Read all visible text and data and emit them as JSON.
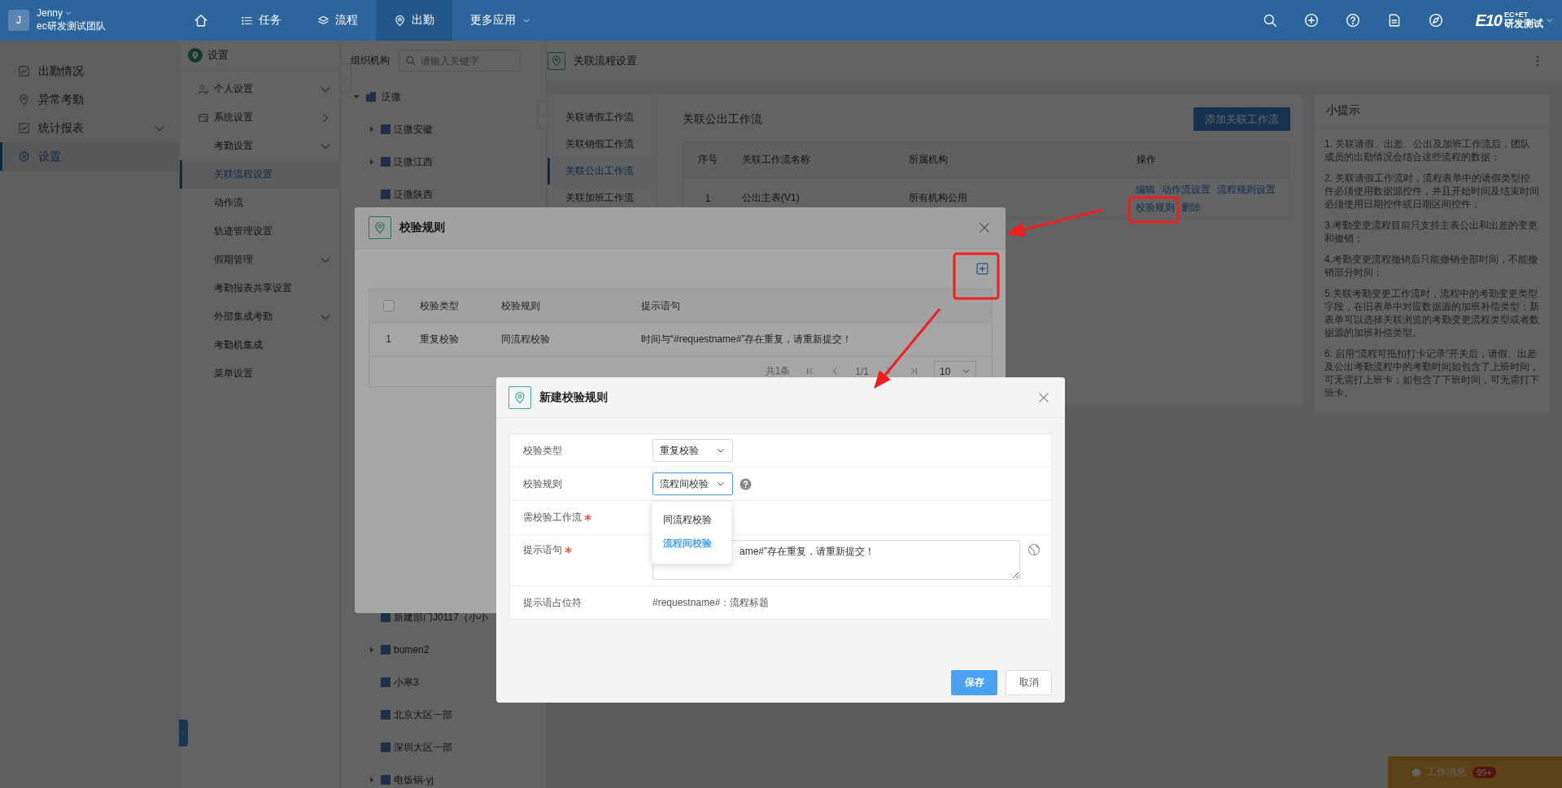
{
  "top_bar": {
    "avatar": "J",
    "user": "Jenny",
    "team": "ec研发测试团队",
    "nav": [
      {
        "label": "任务",
        "selected": false,
        "dropdown": false
      },
      {
        "label": "流程",
        "selected": false,
        "dropdown": false
      },
      {
        "label": "出勤",
        "selected": true,
        "dropdown": false
      },
      {
        "label": "更多应用",
        "selected": false,
        "dropdown": true
      }
    ],
    "logo": {
      "mark": "E10",
      "top": "EC+ET",
      "bottom": "研发测试"
    }
  },
  "sidebar": {
    "items": [
      {
        "label": "出勤情况",
        "selected": false,
        "kind": "item"
      },
      {
        "label": "异常考勤",
        "selected": false,
        "kind": "item"
      },
      {
        "label": "统计报表",
        "selected": false,
        "kind": "group"
      },
      {
        "label": "设置",
        "selected": true,
        "kind": "item"
      }
    ]
  },
  "settings_menu": {
    "title": "设置",
    "items": [
      {
        "label": "个人设置",
        "selected": false,
        "kind": "group"
      },
      {
        "label": "系统设置",
        "selected": false,
        "kind": "page"
      },
      {
        "label": "考勤设置",
        "selected": false,
        "kind": "group"
      },
      {
        "label": "关联流程设置",
        "selected": true,
        "kind": "item"
      },
      {
        "label": "动作流",
        "selected": false,
        "kind": "item"
      },
      {
        "label": "轨迹管理设置",
        "selected": false,
        "kind": "item"
      },
      {
        "label": "假期管理",
        "selected": false,
        "kind": "group"
      },
      {
        "label": "考勤报表共享设置",
        "selected": false,
        "kind": "item"
      },
      {
        "label": "外部集成考勤",
        "selected": false,
        "kind": "group"
      },
      {
        "label": "考勤机集成",
        "selected": false,
        "kind": "item"
      },
      {
        "label": "菜单设置",
        "selected": false,
        "kind": "item"
      }
    ]
  },
  "org_tree": {
    "title": "组织机构",
    "search": {
      "placeholder": "请输入关键字"
    },
    "root": {
      "label": "泛微",
      "expanded": true,
      "children": [
        {
          "label": "泛微安徽",
          "kind": "branch"
        },
        {
          "label": "泛微江西",
          "kind": "branch"
        },
        {
          "label": "泛微陕西",
          "kind": "leaf"
        }
      ],
      "children_after_dialog": [
        {
          "label": "新建部门J0117（小小",
          "kind": "leaf"
        },
        {
          "label": "bumen2",
          "kind": "branch"
        },
        {
          "label": "小寒3",
          "kind": "leaf"
        },
        {
          "label": "北京大区一部",
          "kind": "leaf"
        },
        {
          "label": "深圳大区一部",
          "kind": "leaf"
        },
        {
          "label": "电饭锅-yj",
          "kind": "branch"
        }
      ]
    }
  },
  "main": {
    "title": "关联流程设置",
    "tabs": [
      {
        "label": "关联请假工作流",
        "selected": false
      },
      {
        "label": "关联销假工作流",
        "selected": false
      },
      {
        "label": "关联公出工作流",
        "selected": true
      },
      {
        "label": "关联加班工作流",
        "selected": false
      }
    ],
    "panel": {
      "title": "关联公出工作流",
      "add_button": "添加关联工作流",
      "table": {
        "columns": [
          "序号",
          "关联工作流名称",
          "所属机构",
          "操作"
        ],
        "rows": [
          {
            "cells": [
              "1",
              "公出主表(V1)",
              "所有机构公用"
            ],
            "actions": [
              "编辑",
              "动作流设置",
              "流程规则设置",
              "校验规则",
              "删除"
            ]
          }
        ]
      }
    },
    "tips": {
      "title": "小提示",
      "items": [
        "1. 关联请假、出差、公出及加班工作流后，团队成员的出勤情况会结合这些流程的数据；",
        "2. 关联请假工作流时，流程表单中的请假类型控件必须使用数据源控件，并且开始时间及结束时间必须使用日期控件或日期区间控件；",
        "3.考勤变更流程目前只支持主表公出和出差的变更和撤销；",
        "4.考勤变更流程撤销后只能撤销全部时间，不能撤销部分时间；",
        "5.关联考勤变更工作流时，流程中的考勤变更类型字段，在旧表单中对应数据源的加班补偿类型；新表单可以选择关联浏览的考勤变更流程类型或者数据源的加班补偿类型。",
        "6. 启用“流程可抵扣打卡记录”开关后，请假、出差及公出考勤流程中的考勤时间如包含了上班时间，可无需打上班卡；如包含了下班时间，可无需打下班卡。"
      ]
    }
  },
  "work_message": {
    "label": "工作消息",
    "badge": "99+"
  },
  "rules_dialog": {
    "title": "校验规则",
    "table": {
      "header_checkbox": {
        "checked": false
      },
      "columns": [
        "校验类型",
        "校验规则",
        "提示语句"
      ],
      "rows": [
        {
          "index": "1",
          "cells": [
            "重复校验",
            "同流程校验",
            "时间与“#requestname#”存在重复，请重新提交！"
          ]
        }
      ]
    },
    "pagination": {
      "total": "共1条",
      "page": "1/1",
      "page_size": "10"
    }
  },
  "new_rule_dialog": {
    "title": "新建校验规则",
    "fields": [
      {
        "kind": "select",
        "label": "校验类型",
        "value": "重复校验",
        "required": false,
        "focused": false
      },
      {
        "kind": "select",
        "label": "校验规则",
        "value": "流程间校验",
        "required": false,
        "focused": true,
        "help": true
      },
      {
        "kind": "empty",
        "label": "需校验工作流",
        "required": true
      },
      {
        "kind": "textarea",
        "label": "提示语句",
        "value": "ame#”存在重复，请重新提交！",
        "required": true
      },
      {
        "kind": "text",
        "label": "提示语占位符",
        "value": "#requestname#：流程标题",
        "required": false
      }
    ],
    "dropdown": {
      "options": [
        {
          "label": "同流程校验",
          "selected": false
        },
        {
          "label": "流程间校验",
          "selected": true
        }
      ]
    },
    "save": "保存",
    "cancel": "取消"
  }
}
